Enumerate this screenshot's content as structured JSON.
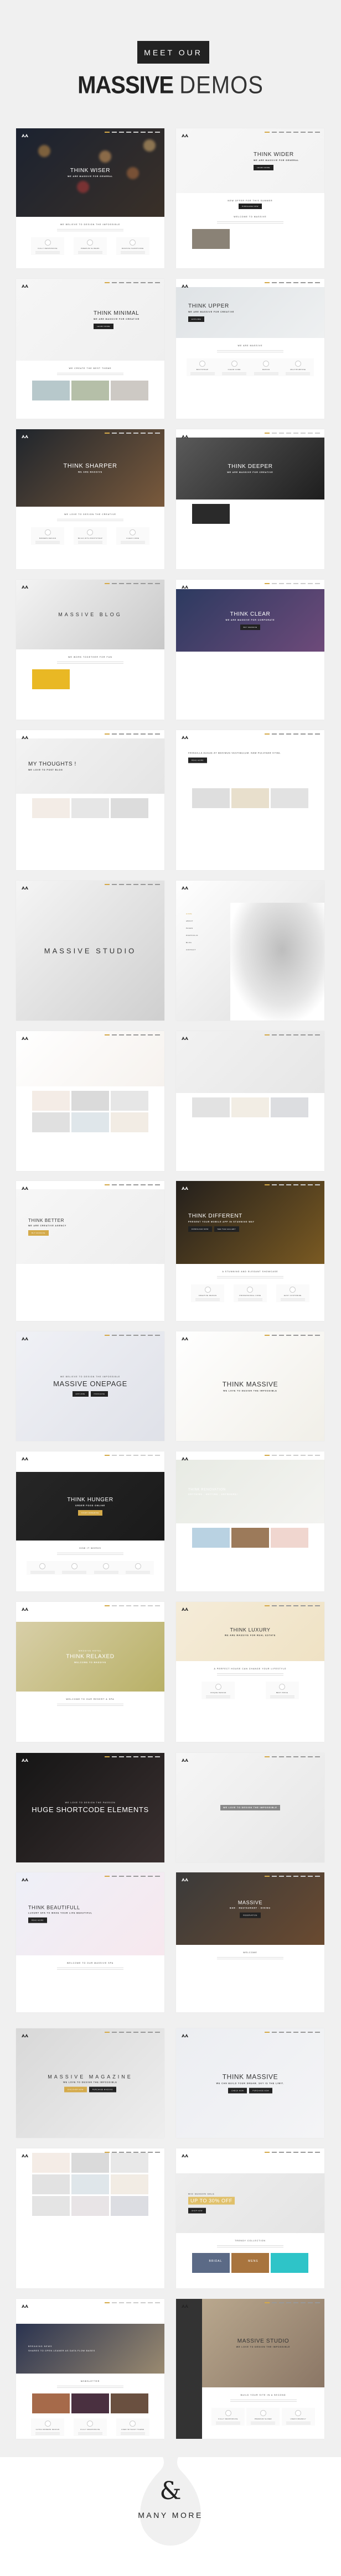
{
  "header": {
    "kicker": "MEET OUR",
    "title_bold": "MASSIVE",
    "title_light": "DEMOS"
  },
  "logo": "MASSIVE",
  "colors": {
    "background": "#f0f0f0",
    "accent": "#d4aa4a",
    "dark": "#222222"
  },
  "cards": [
    {
      "title": "THINK WISER",
      "subtitle": "WE ARE MASSIVE FOR GENERAL",
      "heading": "WE BELIEVE TO DESIGN THE IMPOSSIBLE",
      "features": [
        "FULLY RESPONSIVE",
        "PREMIUM SLIDERS",
        "MASSIVE SHORTCODE"
      ],
      "colors": [
        "#1b2230",
        "#3a3028"
      ]
    },
    {
      "title": "THINK WIDER",
      "subtitle": "WE ARE MASSIVE FOR GENERAL",
      "buttons": [
        "LEARN MORE"
      ],
      "heading": "NEW OFFER FOR THIS SUMMER",
      "buttons2": [
        "PURCHASE NOW"
      ],
      "heading2": "WELCOME TO MASSIVE",
      "tiles": [
        "#8a8276"
      ],
      "colors": [
        "#f7f7f7",
        "#f2f2f2"
      ]
    },
    {
      "title": "THINK MINIMAL",
      "subtitle": "WE ARE MASSIVE FOR CREATIVE",
      "buttons": [
        "LEARN MORE"
      ],
      "tiles": [
        "#b7c8cb",
        "#b5bfa8",
        "#cdc9c4"
      ],
      "heading": "WE CREATE THE BEST THEME",
      "colors": [
        "#f6f6f6",
        "#efefef"
      ]
    },
    {
      "title": "THINK UPPER",
      "subtitle": "WE ARE MASSIVE FOR CREATIVE",
      "buttons": [
        "EXPLORE"
      ],
      "heading": "WE ARE MASSIVE",
      "features": [
        "BOOTSTRAP",
        "CLEAR CODE",
        "DESIGN",
        "MULTIPURPOSE"
      ],
      "colors": [
        "#dfe3e6",
        "#eef0f1"
      ]
    },
    {
      "title": "THINK SHARPER",
      "subtitle": "WE ARE MASSIVE",
      "heading": "WE LOVE TO DESIGN THE CREATIVE",
      "features": [
        "MODERN DESIGN",
        "BUILD WITH BOOTSTRAP",
        "CLEAN CODE"
      ],
      "colors": [
        "#1f252c",
        "#7a5a3c"
      ]
    },
    {
      "title": "THINK DEEPER",
      "subtitle": "WE ARE MASSIVE FOR CREATIVE",
      "tiles": [
        "#2a2a2a"
      ],
      "colors": [
        "#5a5a5a",
        "#1e1e1e"
      ]
    },
    {
      "title": "MASSIVE BLOG",
      "heading": "WE WORK TOGETHER FOR FUN",
      "tiles": [
        "#e9b824"
      ],
      "colors": [
        "#f4f4f4",
        "#c8c8c8"
      ]
    },
    {
      "title": "THINK CLEAR",
      "subtitle": "WE ARE MASSIVE FOR CORPORATE",
      "buttons": [
        "BUY MASSIVE"
      ],
      "colors": [
        "#2c3a60",
        "#6e4a7a"
      ]
    },
    {
      "title": "MY THOUGHTS !",
      "subtitle": "WE LOVE TO POST BLOG",
      "tiles": [
        "#f3ece6",
        "#e6e6e6",
        "#dcdcdc"
      ],
      "colors": [
        "#f3f3f3",
        "#e4e4e4"
      ]
    },
    {
      "title": "FRINGILLA AUGUE AT MAXIMUS VESTIBULUM. NAM PULVINAR VITAE.",
      "buttons": [
        "READ MORE"
      ],
      "tiles": [
        "#dedede",
        "#e8dfcc",
        "#e2e2e2"
      ],
      "colors": [
        "#ffffff",
        "#ffffff"
      ]
    },
    {
      "title": "MASSIVE STUDIO",
      "colors": [
        "#f5f5f5",
        "#cfcfcf"
      ]
    },
    {
      "sidenav": [
        "HOME",
        "ABOUT",
        "PAGES",
        "PORTFOLIO",
        "BLOG",
        "CONTACT"
      ],
      "colors": [
        "#ffffff",
        "#dcdcdc"
      ]
    },
    {
      "tiles": [
        "#f4ece6",
        "#dadada",
        "#e6e6e6",
        "#e0e0e0",
        "#dfe6ea",
        "#f2ece4"
      ],
      "colors": [
        "#ffffff",
        "#f6f2ee"
      ]
    },
    {
      "tiles": [
        "#e2e2e2",
        "#f2ede4",
        "#dcdde0"
      ],
      "colors": [
        "#f2f2f2",
        "#e6e6e6"
      ]
    },
    {
      "title": "THINK BETTER",
      "subtitle": "WE ARE CREATIVE AGENCY",
      "buttons": [
        "BUY MASSIVE"
      ],
      "colors": [
        "#f7f7f7",
        "#ededed"
      ]
    },
    {
      "title": "THINK DIFFERENT",
      "subtitle": "PRESENT YOUR MOBILE APP IN STUNNING WAY",
      "buttons": [
        "DOWNLOAD NOW",
        "SEE THE GALLERY"
      ],
      "heading": "A STUNNING AND ELEGANT SHOWCASE",
      "features": [
        "CREATIVE DESIGN",
        "PROFESSIONAL CODE",
        "EASY CUSTOMIZE"
      ],
      "colors": [
        "#231f1c",
        "#7a5a22"
      ]
    },
    {
      "kicker": "WE BELIEVE TO DESIGN THE IMPOSSIBLE",
      "title": "MASSIVE ONEPAGE",
      "buttons": [
        "EXPLORE",
        "PURCHASE"
      ],
      "colors": [
        "#f0f1f6",
        "#dfe1e8"
      ]
    },
    {
      "title": "THINK MASSIVE",
      "subtitle": "WE LOVE TO DESIGN THE IMPOSSIBLE",
      "colors": [
        "#ffffff",
        "#f1efe8"
      ]
    },
    {
      "title": "THINK HUNGER",
      "subtitle": "ORDER FOOD ONLINE",
      "buttons": [
        "START ORDERING"
      ],
      "heading": "HOW IT WORKS",
      "features": [
        "",
        "",
        "",
        ""
      ],
      "colors": [
        "#262626",
        "#1a1a1a"
      ]
    },
    {
      "title": "THINK RENOVATION",
      "subtitle": "ANYTHING , ANYTIME , ANYWHERE!",
      "tiles": [
        "#b9d2e2",
        "#9c7a5a",
        "#f0d6cf"
      ],
      "colors": [
        "#e8ebe4",
        "#f3f3f0"
      ]
    },
    {
      "kicker": "MASSIVE HOTEL",
      "title": "THINK RELAXED",
      "subtitle": "WELCOME TO MASSIVE",
      "heading": "WELCOME TO OUR RESERT & SPA",
      "colors": [
        "#d8cfa8",
        "#b8b066"
      ]
    },
    {
      "title": "THINK LUXURY",
      "subtitle": "WE ARE MASSIVE FOR REAL ESTATE",
      "heading": "A PERFECT HOUSE CAN CHANGE YOUR LIFESTYLE",
      "features": [
        "UNIQUE DESIGN",
        "BEST PRICE"
      ],
      "colors": [
        "#f5ecd9",
        "#efe2c4"
      ]
    },
    {
      "kicker": "WE LOVE TO DESIGN THE PASSION",
      "title": "HUGE SHORTCODE ELEMENTS",
      "colors": [
        "#151515",
        "#3a3030"
      ]
    },
    {
      "subtitle": "WE LOVE TO DESIGN THE IMPOSSIBLE",
      "colors": [
        "#f6f6f6",
        "#e6e6e6"
      ]
    },
    {
      "title": "THINK BEAUTIFULL",
      "subtitle": "LUXURY SPA TO MAKE YOUR LIFE BEAUTIFUL",
      "buttons": [
        "READ MORE"
      ],
      "heading": "WELCOME TO OUR MASSIVE SPA",
      "colors": [
        "#eef0f8",
        "#f7e8ee"
      ]
    },
    {
      "title": "MASSIVE",
      "subtitle": "BAR · RESTAURANT · DINING",
      "heading": "WELCOME",
      "buttons": [
        "RESERVATION"
      ],
      "colors": [
        "#3a3a3a",
        "#6a4a30"
      ]
    },
    {
      "title": "MASSIVE MAGAZINE",
      "subtitle": "WE LOVE TO DESIGN THE IMPOSSIBLE",
      "buttons": [
        "DISCOVER NOW",
        "PURCHASE MASSIVE"
      ],
      "colors": [
        "#d8d8d8",
        "#eeeeee"
      ]
    },
    {
      "title": "THINK MASSIVE",
      "subtitle": "WE CAN BUILD YOUR DREAM. SKY IS THE LIMIT.",
      "buttons": [
        "CHECK NOW",
        "PURCHASE NOW"
      ],
      "colors": [
        "#eceef2",
        "#f4f4f6"
      ]
    },
    {
      "tiles": [
        "#f4ece6",
        "#dadada",
        "#e8e8e8",
        "#e2e2e2",
        "#dfe6ea",
        "#f2ece4",
        "#e4e4e4",
        "#e8e4e6",
        "#dcdde2"
      ],
      "colors": [
        "#ffffff",
        "#ffffff"
      ]
    },
    {
      "kicker": "MID SEASON SALE",
      "title": "UP TO 30% OFF",
      "buttons": [
        "SHOP NOW"
      ],
      "tiles": [
        "#5b6a86",
        "#a8743e",
        "#2ec4c8"
      ],
      "tile_labels": [
        "BRIDAL",
        "MENS",
        ""
      ],
      "heading": "TRENDY COLLECTION",
      "colors": [
        "#eeeeee",
        "#e4e4e4"
      ]
    },
    {
      "kicker": "BREAKING NEWS",
      "title": "SHARES TO OPEN LEANER AS DATA FLOW BASES",
      "heading": "NEWSLETTER",
      "tiles": [
        "#a66a4a",
        "#4a3040",
        "#6a5040"
      ],
      "features": [
        "ULTRA MODERN DESIGN",
        "FULLY RESPONSIVE",
        "USER WITHOUT THEME"
      ],
      "colors": [
        "#2a3350",
        "#9a8a70"
      ]
    },
    {
      "title": "MASSIVE STUDIO",
      "subtitle": "WE LOVE TO DESIGN THE IMPOSSIBLE",
      "heading": "BUILD YOUR SITE IN A SECOND",
      "features": [
        "FULLY RESPONSIVE",
        "PREMIUM SLIDER",
        "USER FRIENDLY"
      ],
      "colors": [
        "#b9a88e",
        "#857060"
      ]
    }
  ],
  "footer": {
    "ampersand": "&",
    "label": "MANY MORE"
  }
}
